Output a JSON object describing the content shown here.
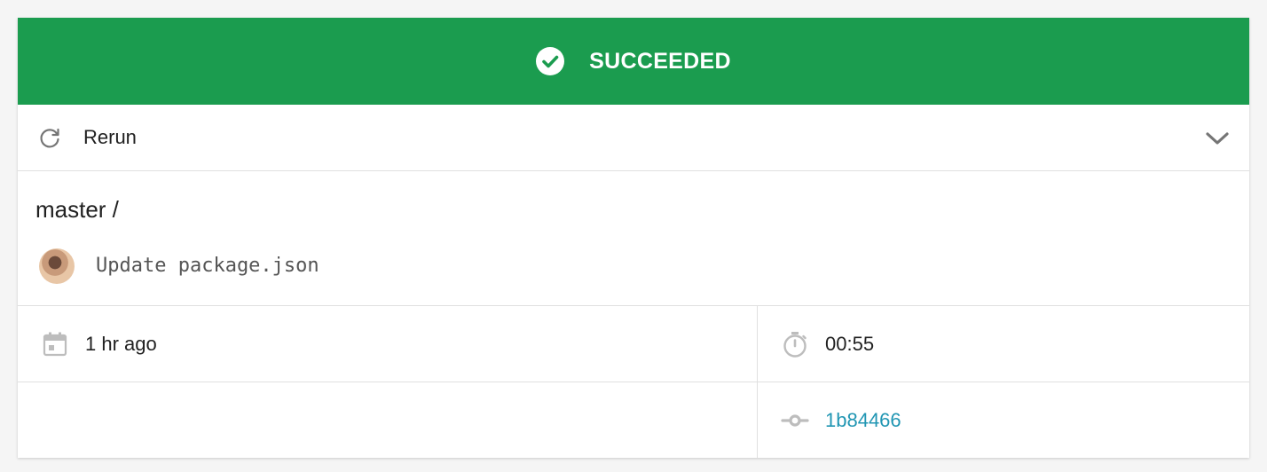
{
  "status": {
    "label": "SUCCEEDED",
    "color": "#1b9c4f",
    "icon": "check-circle-icon"
  },
  "actions": {
    "rerun_label": "Rerun",
    "rerun_icon": "refresh-icon",
    "expand_icon": "chevron-down-icon"
  },
  "commit": {
    "branch": "master /",
    "message": "Update package.json",
    "avatar": "avatar"
  },
  "info": {
    "started": "1 hr ago",
    "started_icon": "calendar-icon",
    "duration": "00:55",
    "duration_icon": "stopwatch-icon",
    "commit_sha": "1b84466",
    "commit_icon": "commit-icon",
    "link_color": "#2196b3"
  }
}
